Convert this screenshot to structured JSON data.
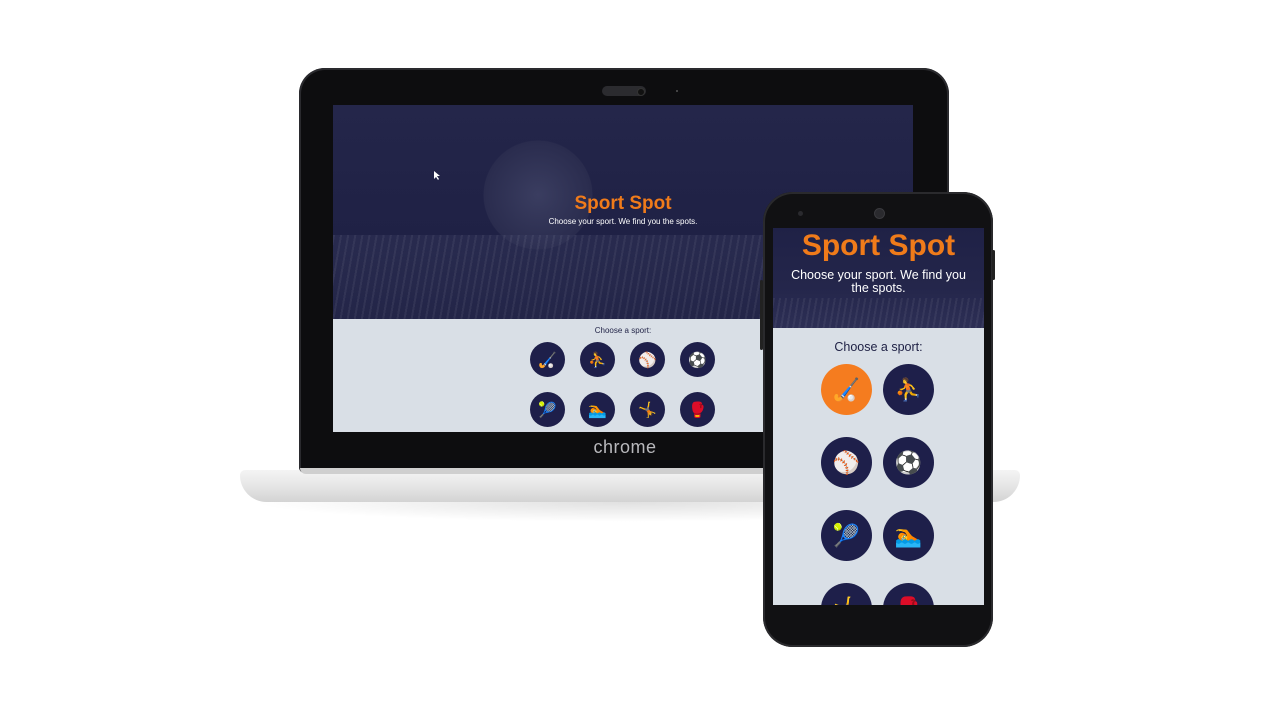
{
  "laptop": {
    "brand": "chrome",
    "app": {
      "title": "Sport Spot",
      "subtitle": "Choose your sport. We find you the spots.",
      "choose_label": "Choose a sport:"
    },
    "sports": [
      {
        "name": "hockey",
        "glyph": "🏑"
      },
      {
        "name": "basketball",
        "glyph": "⛹"
      },
      {
        "name": "baseball",
        "glyph": "⚾"
      },
      {
        "name": "soccer",
        "glyph": "⚽"
      },
      {
        "name": "tennis",
        "glyph": "🎾"
      },
      {
        "name": "swimming",
        "glyph": "🏊"
      },
      {
        "name": "gymnastics",
        "glyph": "🤸"
      },
      {
        "name": "boxing",
        "glyph": "🥊"
      }
    ]
  },
  "phone": {
    "app": {
      "title": "Sport Spot",
      "subtitle": "Choose your sport. We find you the spots.",
      "choose_label": "Choose a sport:"
    },
    "sports": [
      {
        "name": "hockey",
        "glyph": "🏑",
        "active": true
      },
      {
        "name": "basketball",
        "glyph": "⛹"
      },
      {
        "name": "baseball",
        "glyph": "⚾"
      },
      {
        "name": "soccer",
        "glyph": "⚽"
      },
      {
        "name": "tennis",
        "glyph": "🎾"
      },
      {
        "name": "swimming",
        "glyph": "🏊"
      },
      {
        "name": "gymnastics",
        "glyph": "🤸"
      },
      {
        "name": "boxing",
        "glyph": "🥊"
      }
    ]
  },
  "colors": {
    "accent": "#f07b1a",
    "navy": "#1e1f4a",
    "panel": "#d9dfe6"
  }
}
